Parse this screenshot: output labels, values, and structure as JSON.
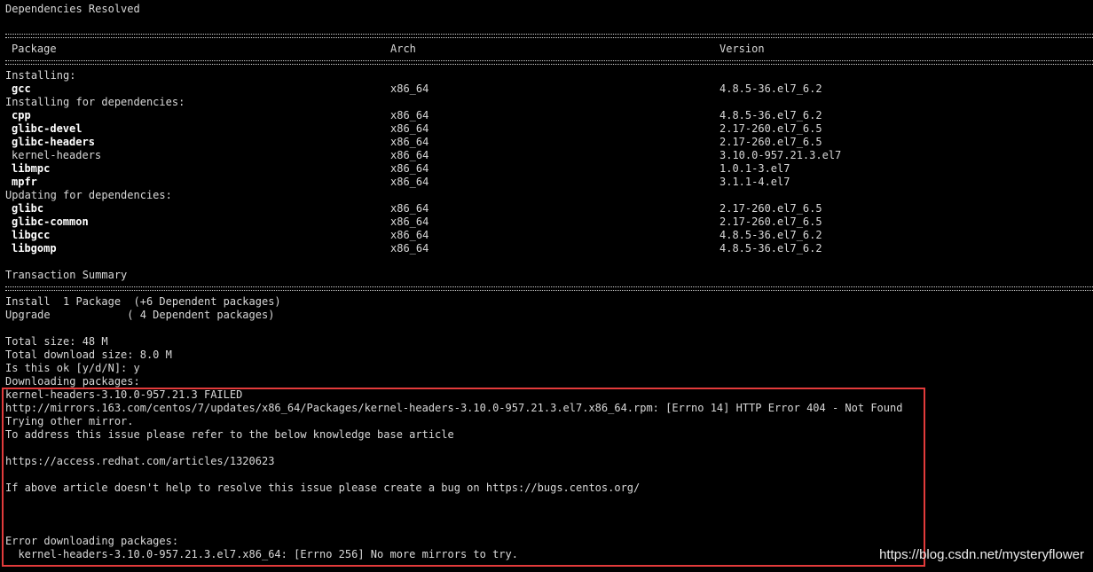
{
  "title_line": "Dependencies Resolved",
  "table": {
    "headers": {
      "package": "Package",
      "arch": "Arch",
      "version": "Version"
    },
    "sections": [
      {
        "label": "Installing:",
        "rows": [
          {
            "name": "gcc",
            "arch": "x86_64",
            "version": "4.8.5-36.el7_6.2",
            "bold": true
          }
        ]
      },
      {
        "label": "Installing for dependencies:",
        "rows": [
          {
            "name": "cpp",
            "arch": "x86_64",
            "version": "4.8.5-36.el7_6.2",
            "bold": true
          },
          {
            "name": "glibc-devel",
            "arch": "x86_64",
            "version": "2.17-260.el7_6.5",
            "bold": true
          },
          {
            "name": "glibc-headers",
            "arch": "x86_64",
            "version": "2.17-260.el7_6.5",
            "bold": true
          },
          {
            "name": "kernel-headers",
            "arch": "x86_64",
            "version": "3.10.0-957.21.3.el7",
            "bold": false
          },
          {
            "name": "libmpc",
            "arch": "x86_64",
            "version": "1.0.1-3.el7",
            "bold": true
          },
          {
            "name": "mpfr",
            "arch": "x86_64",
            "version": "3.1.1-4.el7",
            "bold": true
          }
        ]
      },
      {
        "label": "Updating for dependencies:",
        "rows": [
          {
            "name": "glibc",
            "arch": "x86_64",
            "version": "2.17-260.el7_6.5",
            "bold": true
          },
          {
            "name": "glibc-common",
            "arch": "x86_64",
            "version": "2.17-260.el7_6.5",
            "bold": true
          },
          {
            "name": "libgcc",
            "arch": "x86_64",
            "version": "4.8.5-36.el7_6.2",
            "bold": true
          },
          {
            "name": "libgomp",
            "arch": "x86_64",
            "version": "4.8.5-36.el7_6.2",
            "bold": true
          }
        ]
      }
    ]
  },
  "summary": {
    "title": "Transaction Summary",
    "install_line": "Install  1 Package  (+6 Dependent packages)",
    "upgrade_line": "Upgrade            ( 4 Dependent packages)",
    "total_size": "Total size: 48 M",
    "total_download_size": "Total download size: 8.0 M",
    "prompt": "Is this ok [y/d/N]: y",
    "downloading": "Downloading packages:"
  },
  "error_block": {
    "failed": "kernel-headers-3.10.0-957.21.3 FAILED",
    "url_error": "http://mirrors.163.com/centos/7/updates/x86_64/Packages/kernel-headers-3.10.0-957.21.3.el7.x86_64.rpm: [Errno 14] HTTP Error 404 - Not Found",
    "trying": "Trying other mirror.",
    "address": "To address this issue please refer to the below knowledge base article",
    "kb_url": "https://access.redhat.com/articles/1320623",
    "bug_note": "If above article doesn't help to resolve this issue please create a bug on https://bugs.centos.org/",
    "error_downloading": "Error downloading packages:",
    "no_mirrors": "  kernel-headers-3.10.0-957.21.3.el7.x86_64: [Errno 256] No more mirrors to try."
  },
  "watermark": "https://blog.csdn.net/mysteryflower",
  "colors": {
    "background": "#000000",
    "text": "#d8d8d8",
    "highlight_border": "#e23b3b"
  }
}
